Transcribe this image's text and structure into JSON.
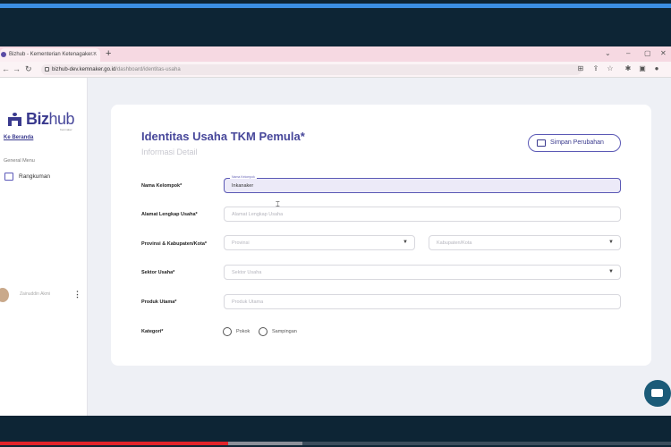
{
  "browser": {
    "tab_title": "Bizhub - Kementerian Ketenagaker...",
    "tab_close": "×",
    "new_tab": "+",
    "url_host": "bizhub-dev.kemnaker.go.id",
    "url_path": "/dashboard/identitas-usaha"
  },
  "sidebar": {
    "logo_text_bold": "Biz",
    "logo_text_light": "hub",
    "logo_sub": "Kemnaker",
    "home_link": "Ke Beranda",
    "section_label": "General Menu",
    "menu_item": "Rangkuman",
    "user_name": "Zainuddin Akmi",
    "user_menu": "⋮"
  },
  "page": {
    "title": "Identitas Usaha TKM Pemula*",
    "subtitle": "Informasi Detail",
    "save_button": "Simpan Perubahan"
  },
  "form": {
    "nama_kelompok_label": "Nama Kelompok*",
    "nama_kelompok_float": "Nama Kelompok",
    "nama_kelompok_value": "Inkanaker",
    "alamat_label": "Alamat Lengkap Usaha*",
    "alamat_placeholder": "Alamat Lengkap Usaha",
    "provinsi_label": "Provinsi & Kabupaten/Kota*",
    "provinsi_placeholder": "Provinsi",
    "kabupaten_placeholder": "Kabupaten/Kota",
    "sektor_label": "Sektor Usaha*",
    "sektor_placeholder": "Sektor Usaha",
    "produk_label": "Produk Utama*",
    "produk_placeholder": "Produk Utama",
    "kategori_label": "Kategori*",
    "kategori_options": [
      "Pokok",
      "Sampingan"
    ]
  },
  "video": {
    "progress_fraction": 0.34
  }
}
